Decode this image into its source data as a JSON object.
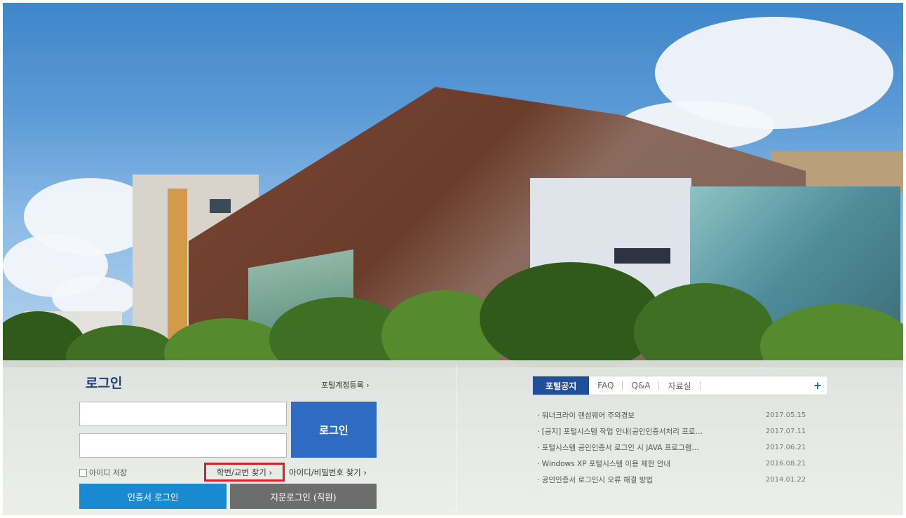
{
  "login": {
    "title": "로그인",
    "portal_register": "포털계정등록 ›",
    "login_button": "로그인",
    "remember_id": "아이디 저장",
    "find_student_id": "학번/교번 찾기 ›",
    "find_id_pw": "아이디/비밀번호 찾기 ›",
    "cert_login": "인증서 로그인",
    "finger_login": "지문로그인 (직원)"
  },
  "notice": {
    "tabs": [
      "포털공지",
      "FAQ",
      "Q&A",
      "자료실"
    ],
    "more": "+",
    "items": [
      {
        "text": "· 워너크라이 랜섬웨어 주의경보",
        "date": "2017.05.15"
      },
      {
        "text": "· [공지] 포털시스템 작업 안내(공인인증서처리 프로…",
        "date": "2017.07.11"
      },
      {
        "text": "· 포털시스템 공인인증서 로그인 시 JAVA 프로그램…",
        "date": "2017.06.21"
      },
      {
        "text": "· Windows XP 포털시스템 이용 제한 안내",
        "date": "2016.08.21"
      },
      {
        "text": "· 공인인증서 로그인시 오류 해결 방법",
        "date": "2014.01.22"
      }
    ]
  },
  "colors": {
    "primary_blue": "#2d6cc0",
    "cert_blue": "#1a8ad0",
    "finger_gray": "#6d6d6d",
    "highlight_red": "#d6202a",
    "tab_active": "#1f4f9a"
  }
}
